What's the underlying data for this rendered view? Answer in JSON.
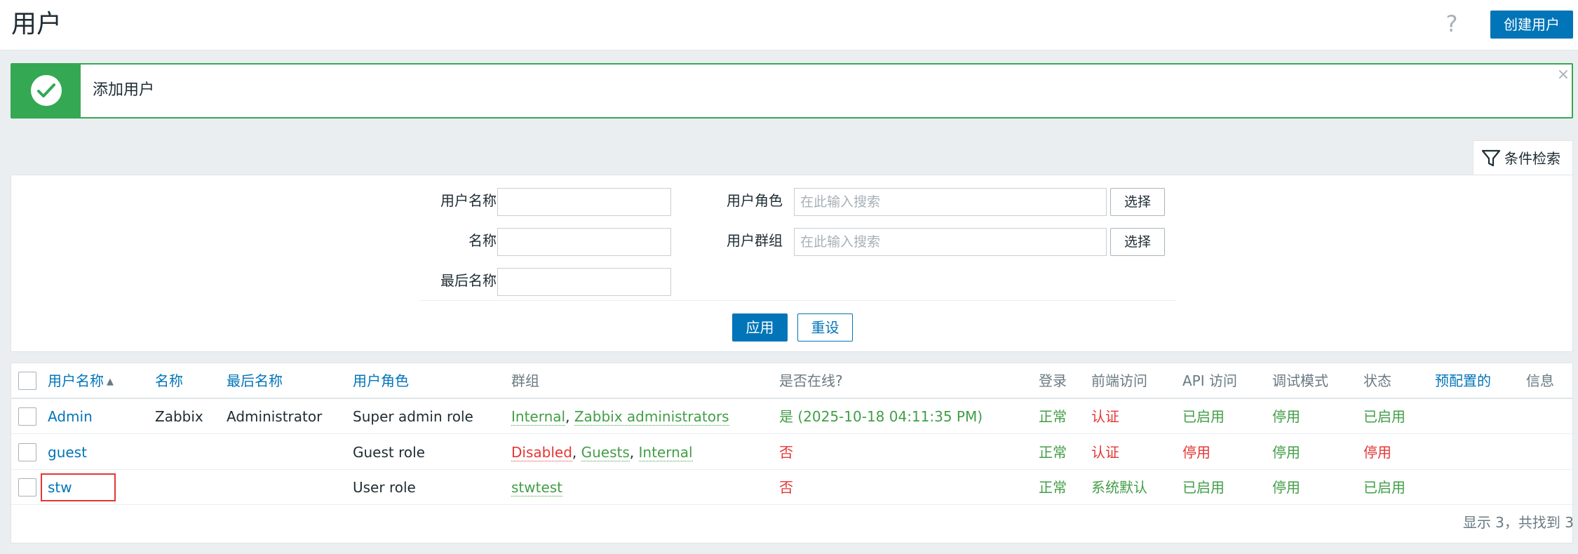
{
  "header": {
    "title": "用户",
    "help_icon": "?",
    "create_button": "创建用户"
  },
  "alert": {
    "message": "添加用户",
    "close_icon": "×"
  },
  "filter": {
    "tab_label": "条件检索",
    "username_label": "用户名称",
    "name_label": "名称",
    "lastname_label": "最后名称",
    "role_label": "用户角色",
    "role_placeholder": "在此输入搜索",
    "group_label": "用户群组",
    "group_placeholder": "在此输入搜索",
    "select_label": "选择",
    "apply_label": "应用",
    "reset_label": "重设"
  },
  "table": {
    "columns": {
      "username": "用户名称",
      "name": "名称",
      "lastname": "最后名称",
      "role": "用户角色",
      "groups": "群组",
      "online": "是否在线?",
      "login": "登录",
      "frontend": "前端访问",
      "api": "API 访问",
      "debug": "调试模式",
      "status": "状态",
      "provisioned": "预配置的",
      "info": "信息"
    },
    "sort_arrow": "▲",
    "rows": [
      {
        "username": "Admin",
        "name": "Zabbix",
        "lastname": "Administrator",
        "role": "Super admin role",
        "groups": [
          "Internal",
          "Zabbix administrators"
        ],
        "online": "是 (2025-10-18 04:11:35 PM)",
        "login": "正常",
        "frontend": "认证",
        "api": "已启用",
        "debug": "停用",
        "status": "已启用"
      },
      {
        "username": "guest",
        "name": "",
        "lastname": "",
        "role": "Guest role",
        "groups": [
          "Disabled",
          "Guests",
          "Internal"
        ],
        "online": "否",
        "login": "正常",
        "frontend": "认证",
        "api": "停用",
        "debug": "停用",
        "status": "停用"
      },
      {
        "username": "stw",
        "name": "",
        "lastname": "",
        "role": "User role",
        "groups": [
          "stwtest"
        ],
        "online": "否",
        "login": "正常",
        "frontend": "系统默认",
        "api": "已启用",
        "debug": "停用",
        "status": "已启用"
      }
    ],
    "footer": "显示 3，共找到 3",
    "separator": ", "
  },
  "colors": {
    "primary": "#0275b8",
    "success": "#34a853",
    "green_text": "#429e47",
    "red_text": "#e33734"
  }
}
